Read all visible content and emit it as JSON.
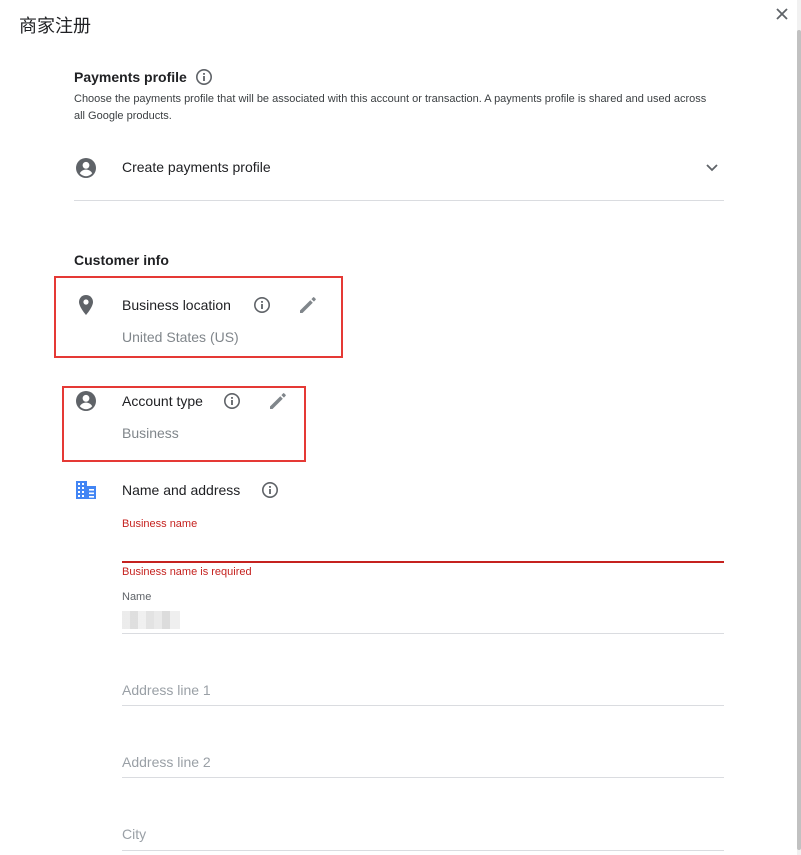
{
  "dialog": {
    "title": "商家注册"
  },
  "payments_profile": {
    "heading": "Payments profile",
    "description": "Choose the payments profile that will be associated with this account or transaction. A payments profile is shared and used across all Google products.",
    "selected": "Create payments profile"
  },
  "customer_info": {
    "heading": "Customer info",
    "business_location": {
      "label": "Business location",
      "value": "United States (US)"
    },
    "account_type": {
      "label": "Account type",
      "value": "Business"
    },
    "name_and_address": {
      "label": "Name and address",
      "business_name_label": "Business name",
      "business_name_error": "Business name is required",
      "name_label": "Name",
      "address_line_1_placeholder": "Address line 1",
      "address_line_2_placeholder": "Address line 2",
      "city_placeholder": "City"
    }
  },
  "colors": {
    "error": "#c5221f",
    "highlight": "#e53935",
    "icon_grey": "#5f6368",
    "building_icon": "#4285f4"
  },
  "icons": {
    "close": "close-icon",
    "info": "info-icon",
    "account": "account-circle-icon",
    "location": "location-pin-icon",
    "edit": "pencil-icon",
    "building": "building-icon",
    "chevron": "chevron-down-icon"
  }
}
